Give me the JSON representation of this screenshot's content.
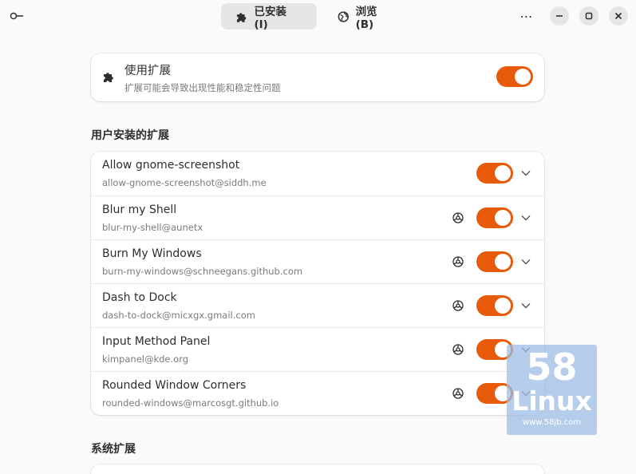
{
  "header": {
    "tabs": [
      {
        "label": "已安装 (I)",
        "icon": "puzzle-icon",
        "active": true
      },
      {
        "label": "浏览 (B)",
        "icon": "globe-icon",
        "active": false
      }
    ],
    "menu_icon": "more-vertical-icon",
    "window_controls": [
      "minimize-icon",
      "maximize-icon",
      "close-icon"
    ]
  },
  "use_extensions": {
    "title": "使用扩展",
    "subtitle": "扩展可能会导致出现性能和稳定性问题",
    "icon": "puzzle-icon",
    "enabled": true
  },
  "user_section": {
    "title": "用户安装的扩展",
    "items": [
      {
        "name": "Allow gnome-screenshot",
        "id": "allow-gnome-screenshot@siddh.me",
        "has_settings": false,
        "enabled": true
      },
      {
        "name": "Blur my Shell",
        "id": "blur-my-shell@aunetx",
        "has_settings": true,
        "enabled": true
      },
      {
        "name": "Burn My Windows",
        "id": "burn-my-windows@schneegans.github.com",
        "has_settings": true,
        "enabled": true
      },
      {
        "name": "Dash to Dock",
        "id": "dash-to-dock@micxgx.gmail.com",
        "has_settings": true,
        "enabled": true
      },
      {
        "name": "Input Method Panel",
        "id": "kimpanel@kde.org",
        "has_settings": true,
        "enabled": true
      },
      {
        "name": "Rounded Window Corners",
        "id": "rounded-windows@marcosgt.github.io",
        "has_settings": true,
        "enabled": true
      }
    ]
  },
  "system_section": {
    "title": "系统扩展"
  },
  "watermark": {
    "number": "58",
    "word": "Linux",
    "url": "www.58jb.com"
  },
  "colors": {
    "accent": "#e65a0a",
    "background": "#fafafa",
    "card": "#ffffff"
  }
}
